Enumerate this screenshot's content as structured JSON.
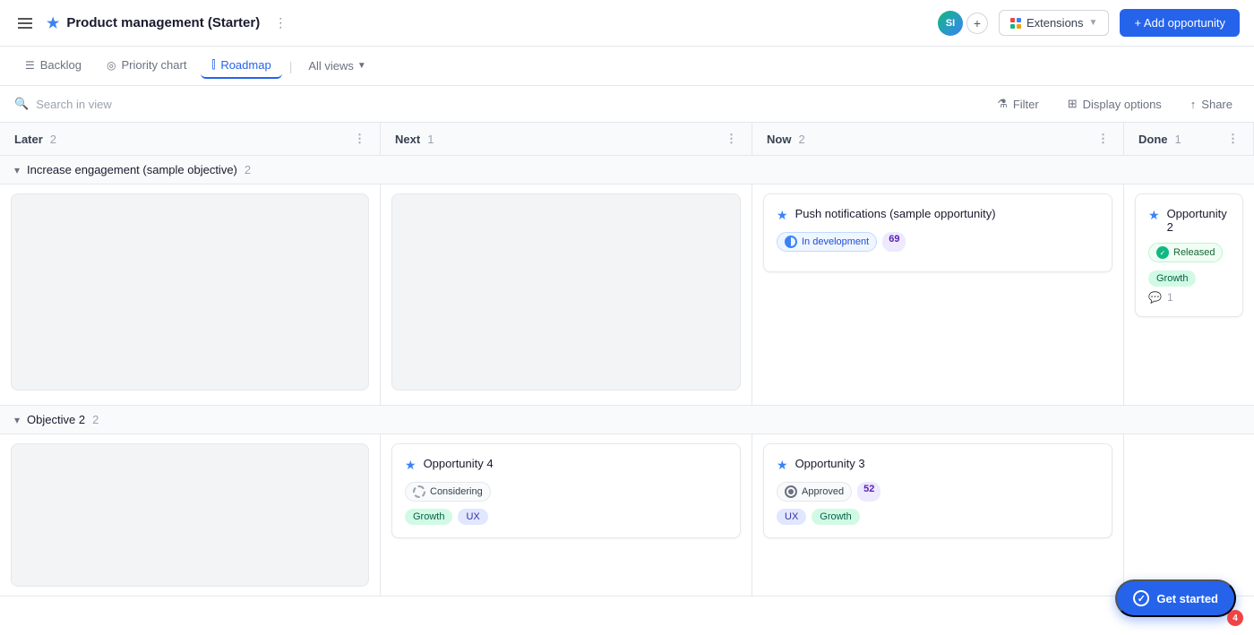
{
  "app": {
    "title": "Product management (Starter)",
    "hamburger_label": "Menu"
  },
  "topnav": {
    "avatar_initials": "SI",
    "extensions_label": "Extensions",
    "add_opportunity_label": "+ Add opportunity"
  },
  "tabs": [
    {
      "id": "backlog",
      "label": "Backlog",
      "active": false
    },
    {
      "id": "priority",
      "label": "Priority chart",
      "active": false
    },
    {
      "id": "roadmap",
      "label": "Roadmap",
      "active": true
    },
    {
      "id": "allviews",
      "label": "All views",
      "active": false
    }
  ],
  "toolbar": {
    "search_placeholder": "Search in view",
    "filter_label": "Filter",
    "display_options_label": "Display options",
    "share_label": "Share"
  },
  "columns": [
    {
      "id": "later",
      "label": "Later",
      "count": "2"
    },
    {
      "id": "next",
      "label": "Next",
      "count": "1"
    },
    {
      "id": "now",
      "label": "Now",
      "count": "2"
    },
    {
      "id": "done",
      "label": "Done",
      "count": "1"
    }
  ],
  "objectives": [
    {
      "id": "obj1",
      "label": "Increase engagement (sample objective)",
      "count": "2",
      "cards": {
        "later": null,
        "next": null,
        "now": {
          "title": "Push notifications (sample opportunity)",
          "status_label": "In development",
          "status_type": "in_development",
          "score": "69"
        },
        "done": {
          "title": "Opportunity 2",
          "status_label": "Released",
          "status_type": "released",
          "tag": "Growth",
          "sub_count": "1"
        }
      }
    },
    {
      "id": "obj2",
      "label": "Objective 2",
      "count": "2",
      "cards": {
        "later": null,
        "next": {
          "title": "Opportunity 4",
          "status_label": "Considering",
          "status_type": "considering",
          "tags": [
            "Growth",
            "UX"
          ]
        },
        "now": {
          "title": "Opportunity 3",
          "status_label": "Approved",
          "status_type": "approved",
          "score": "52",
          "tags": [
            "UX",
            "Growth"
          ]
        },
        "done": null
      }
    }
  ],
  "get_started": {
    "label": "Get started",
    "badge": "4"
  }
}
